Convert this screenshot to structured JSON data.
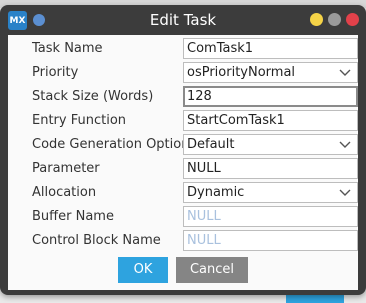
{
  "window": {
    "app_icon_text": "MX",
    "title": "Edit Task"
  },
  "form": {
    "fields": [
      {
        "label": "Task Name",
        "value": "ComTask1",
        "kind": "text"
      },
      {
        "label": "Priority",
        "value": "osPriorityNormal",
        "kind": "select"
      },
      {
        "label": "Stack Size (Words)",
        "value": "128",
        "kind": "text-focused"
      },
      {
        "label": "Entry Function",
        "value": "StartComTask1",
        "kind": "text"
      },
      {
        "label": "Code Generation Option",
        "value": "Default",
        "kind": "select"
      },
      {
        "label": "Parameter",
        "value": "NULL",
        "kind": "text"
      },
      {
        "label": "Allocation",
        "value": "Dynamic",
        "kind": "select"
      },
      {
        "label": "Buffer Name",
        "placeholder": "NULL",
        "kind": "placeholder"
      },
      {
        "label": "Control Block Name",
        "placeholder": "NULL",
        "kind": "placeholder"
      }
    ]
  },
  "buttons": {
    "ok": "OK",
    "cancel": "Cancel"
  },
  "colors": {
    "accent": "#2ea3df",
    "titlebar": "#3c3c3c",
    "close": "#e2414a",
    "minimize": "#f5d347"
  }
}
